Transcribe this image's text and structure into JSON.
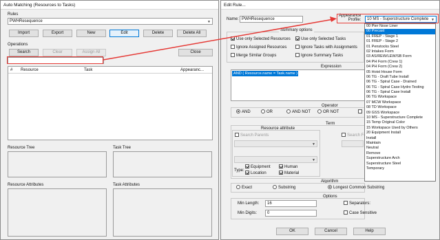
{
  "left": {
    "title": "Auto Matching (Resources to Tasks)",
    "rules_label": "Rules",
    "rules_value": "PWHResequence",
    "buttons": [
      "Import",
      "Export",
      "New",
      "Edit",
      "Delete",
      "Delete All"
    ],
    "ops_label": "Operations",
    "ops_buttons": [
      "Search",
      "Clear",
      "Assign All",
      "Close"
    ],
    "columns": [
      "#",
      "Resource",
      "Task",
      "Appearanc..."
    ],
    "panels": [
      "Resource Tree",
      "Task Tree",
      "Resource Attributes",
      "Task Attributes"
    ]
  },
  "right": {
    "title": "Edit Rule...",
    "name_label": "Name:",
    "name_value": "PWHResequence",
    "appearance_label1": "Appearance",
    "appearance_label2": "Profile:",
    "appearance_value": "10 MS - Superstructure Complete",
    "summary_label": "Summary options",
    "options": [
      "Use only Selected Resources",
      "Use only Selected Tasks",
      "Ignore Assigned Resources",
      "Ignore Tasks with Assignments",
      "Merge Similar Groups",
      "Ignore Summary Tasks"
    ],
    "expression_label": "Expression",
    "expression_value": "AND ( Resource.name = Task.name )",
    "operator_label": "Operator",
    "operators": [
      "AND",
      "OR",
      "AND NOT",
      "OR NOT"
    ],
    "term_label": "Term",
    "res_attr_label": "Resource attribute",
    "search_parents": "Search Parents",
    "search_fe": "Search Fe",
    "type_label": "Type:",
    "types": [
      "Equipment",
      "Human",
      "Location",
      "Material"
    ],
    "algorithm_label": "Algorithm",
    "algorithms": [
      "Exact",
      "Substring",
      "Longest Common Substring"
    ],
    "options_label": "Options",
    "min_length_label": "Min Length:",
    "min_length": "16",
    "min_digits_label": "Min Digits:",
    "min_digits": "0",
    "separators_label": "Separators:",
    "case_label": "Case Sensitive",
    "footer": [
      "OK",
      "Cancel",
      "Help"
    ]
  },
  "dropdown": {
    "items": [
      "00 Pier Nose Liner",
      "00 Precast",
      "01 FREP - Stage 1",
      "01 FREP - Stage 2",
      "01 Penstocks Steel",
      "02 Intakes Form",
      "03 AS/REW/LEW/SB Form",
      "04 PH Form (Crew 1)",
      "04 PH Form (Crew 2)",
      "05 Hoist House Form",
      "06 TG - Draft Tube Install",
      "06 TG - Spiral Case - Drained",
      "06 TG - Spiral Case Hydro Testing",
      "06 TG - Spiral Case Install",
      "06 TG Workspace",
      "07 MCW Workspace",
      "08 TD Workspace",
      "09 GSS Workspace",
      "10 MS - Superstructure Complete",
      "15 Temp Original Color",
      "15 Workspace Used by Others",
      "20 Equipment Install",
      "Install",
      "Maintain",
      "Neutral",
      "Remove",
      "Superstructure Arch",
      "Superstructure Steel",
      "Temporary"
    ],
    "highlighted": 1
  },
  "colors": {
    "accent": "#0078d7",
    "annotation": "#e53935"
  }
}
